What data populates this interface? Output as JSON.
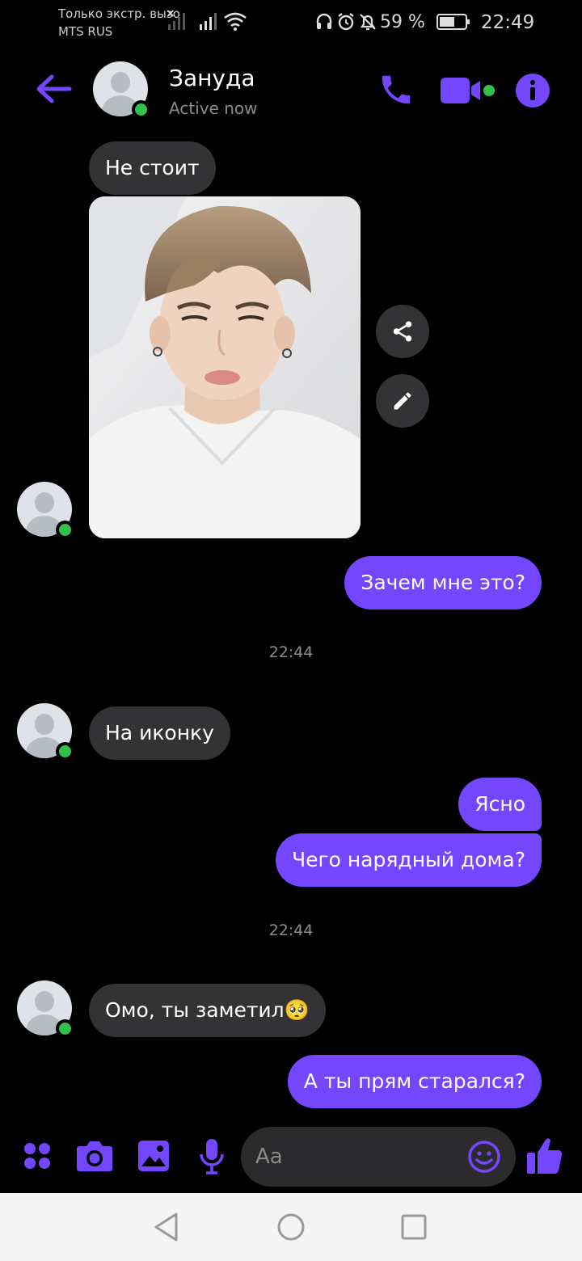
{
  "status_bar": {
    "carrier_line1": "Только экстр. вызо",
    "carrier_line2": "MTS RUS",
    "battery": "59 %",
    "time": "22:49"
  },
  "header": {
    "contact_name": "Зануда",
    "contact_status": "Active now",
    "back_icon": "arrow-left-icon",
    "call_icon": "phone-icon",
    "video_icon": "video-camera-icon",
    "info_icon": "info-icon",
    "accent_color": "#7546ff",
    "online_color": "#31c24d"
  },
  "messages": {
    "m1": "Не стоит",
    "m2": "Зачем мне это?",
    "time1": "22:44",
    "m3": "На иконку",
    "m4": "Ясно",
    "m5": "Чего нарядный дома?",
    "time2": "22:44",
    "m6": "Омо, ты заметил",
    "m6_emoji": "🥺",
    "m7": "А ты прям старался?"
  },
  "photo": {
    "share_icon": "share-icon",
    "edit_icon": "pencil-icon"
  },
  "composer": {
    "placeholder": "Aa",
    "apps_icon": "four-dots-icon",
    "camera_icon": "camera-icon",
    "gallery_icon": "image-icon",
    "mic_icon": "microphone-icon",
    "emoji_icon": "smiley-icon",
    "like_icon": "thumbs-up-icon"
  },
  "nav": {
    "back": "triangle-back-icon",
    "home": "circle-home-icon",
    "recents": "square-recents-icon"
  }
}
